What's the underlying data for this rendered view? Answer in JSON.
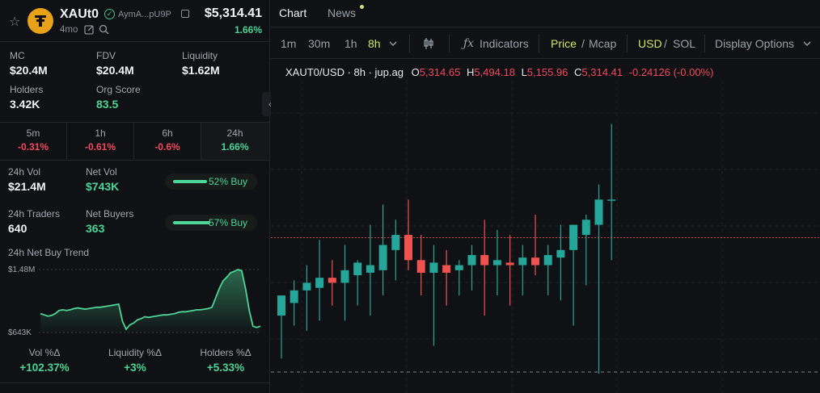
{
  "token": {
    "symbol": "XAUt0",
    "address": "AymA...pU9P",
    "price": "$5,314.41",
    "age": "4mo",
    "change_24h": "1.66%",
    "logo_color": "#e8a21a"
  },
  "stats": [
    {
      "label": "MC",
      "value": "$20.4M"
    },
    {
      "label": "FDV",
      "value": "$20.4M"
    },
    {
      "label": "Liquidity",
      "value": "$1.62M"
    },
    {
      "label": "Holders",
      "value": "3.42K"
    },
    {
      "label": "Org Score",
      "value": "83.5"
    }
  ],
  "timeframes": [
    {
      "label": "5m",
      "value": "-0.31%",
      "dir": "down"
    },
    {
      "label": "1h",
      "value": "-0.61%",
      "dir": "down"
    },
    {
      "label": "6h",
      "value": "-0.6%",
      "dir": "down"
    },
    {
      "label": "24h",
      "value": "1.66%",
      "dir": "up"
    }
  ],
  "volume": {
    "vol_label": "24h Vol",
    "vol_value": "$21.4M",
    "net_vol_label": "Net Vol",
    "net_vol_value": "$743K",
    "buy_pct_1": "52% Buy",
    "buy_frac_1": 0.52,
    "traders_label": "24h Traders",
    "traders_value": "640",
    "net_buyers_label": "Net Buyers",
    "net_buyers_value": "363",
    "buy_pct_2": "57% Buy",
    "buy_frac_2": 0.57
  },
  "trend": {
    "label": "24h Net Buy Trend",
    "max_label": "$1.48M",
    "min_label": "$643K",
    "points": [
      0.3,
      0.28,
      0.26,
      0.27,
      0.3,
      0.35,
      0.36,
      0.35,
      0.36,
      0.38,
      0.39,
      0.38,
      0.37,
      0.38,
      0.39,
      0.4,
      0.4,
      0.41,
      0.42,
      0.43,
      0.44,
      0.45,
      0.18,
      0.05,
      0.12,
      0.15,
      0.2,
      0.22,
      0.25,
      0.24,
      0.25,
      0.26,
      0.27,
      0.28,
      0.28,
      0.29,
      0.3,
      0.32,
      0.33,
      0.33,
      0.34,
      0.35,
      0.36,
      0.36,
      0.37,
      0.38,
      0.4,
      0.55,
      0.7,
      0.82,
      0.88,
      0.95,
      0.97,
      1.0,
      0.98,
      0.7,
      0.35,
      0.1,
      0.08,
      0.1
    ]
  },
  "footer": [
    {
      "label": "Vol %Δ",
      "value": "+102.37%"
    },
    {
      "label": "Liquidity %Δ",
      "value": "+3%"
    },
    {
      "label": "Holders %Δ",
      "value": "+5.33%"
    }
  ],
  "tabs": {
    "chart": "Chart",
    "news": "News"
  },
  "toolbar": {
    "intervals": [
      "1m",
      "30m",
      "1h"
    ],
    "selected_interval": "8h",
    "indicators": "Indicators",
    "price": "Price",
    "mcap": "Mcap",
    "usd": "USD",
    "sol": "SOL",
    "display": "Display Options"
  },
  "ohlc": {
    "pair": "XAUT0/USD · 8h · jup.ag",
    "o": "5,314.65",
    "h": "5,494.18",
    "l": "5,155.96",
    "c": "5,314.41",
    "change": "-0.24126 (-0.00%)"
  },
  "chart_data": {
    "type": "candlestick",
    "colors": {
      "up": "#26a69a",
      "down": "#ef5350"
    },
    "current_price": 5314.41,
    "candles": [
      {
        "o": 5160,
        "h": 5180,
        "l": 5075,
        "c": 5200
      },
      {
        "o": 5185,
        "h": 5230,
        "l": 5140,
        "c": 5210
      },
      {
        "o": 5210,
        "h": 5260,
        "l": 5130,
        "c": 5225
      },
      {
        "o": 5215,
        "h": 5310,
        "l": 5150,
        "c": 5235
      },
      {
        "o": 5235,
        "h": 5270,
        "l": 5180,
        "c": 5225
      },
      {
        "o": 5225,
        "h": 5300,
        "l": 5150,
        "c": 5250
      },
      {
        "o": 5240,
        "h": 5270,
        "l": 5180,
        "c": 5265
      },
      {
        "o": 5245,
        "h": 5340,
        "l": 5160,
        "c": 5260
      },
      {
        "o": 5250,
        "h": 5380,
        "l": 5200,
        "c": 5300
      },
      {
        "o": 5290,
        "h": 5350,
        "l": 5230,
        "c": 5320
      },
      {
        "o": 5320,
        "h": 5390,
        "l": 5250,
        "c": 5270
      },
      {
        "o": 5270,
        "h": 5320,
        "l": 5200,
        "c": 5245
      },
      {
        "o": 5245,
        "h": 5300,
        "l": 5100,
        "c": 5265
      },
      {
        "o": 5260,
        "h": 5290,
        "l": 5180,
        "c": 5245
      },
      {
        "o": 5250,
        "h": 5270,
        "l": 5200,
        "c": 5260
      },
      {
        "o": 5260,
        "h": 5300,
        "l": 5210,
        "c": 5280
      },
      {
        "o": 5280,
        "h": 5350,
        "l": 5160,
        "c": 5260
      },
      {
        "o": 5260,
        "h": 5330,
        "l": 5200,
        "c": 5270
      },
      {
        "o": 5265,
        "h": 5320,
        "l": 5180,
        "c": 5260
      },
      {
        "o": 5260,
        "h": 5300,
        "l": 5200,
        "c": 5275
      },
      {
        "o": 5275,
        "h": 5360,
        "l": 5240,
        "c": 5260
      },
      {
        "o": 5260,
        "h": 5300,
        "l": 5200,
        "c": 5280
      },
      {
        "o": 5275,
        "h": 5340,
        "l": 5190,
        "c": 5290
      },
      {
        "o": 5290,
        "h": 5320,
        "l": 5140,
        "c": 5340
      },
      {
        "o": 5320,
        "h": 5360,
        "l": 5220,
        "c": 5350
      },
      {
        "o": 5340,
        "h": 5420,
        "l": 5045,
        "c": 5390
      },
      {
        "o": 5390,
        "h": 5540,
        "l": 5270,
        "c": 5390
      }
    ]
  }
}
